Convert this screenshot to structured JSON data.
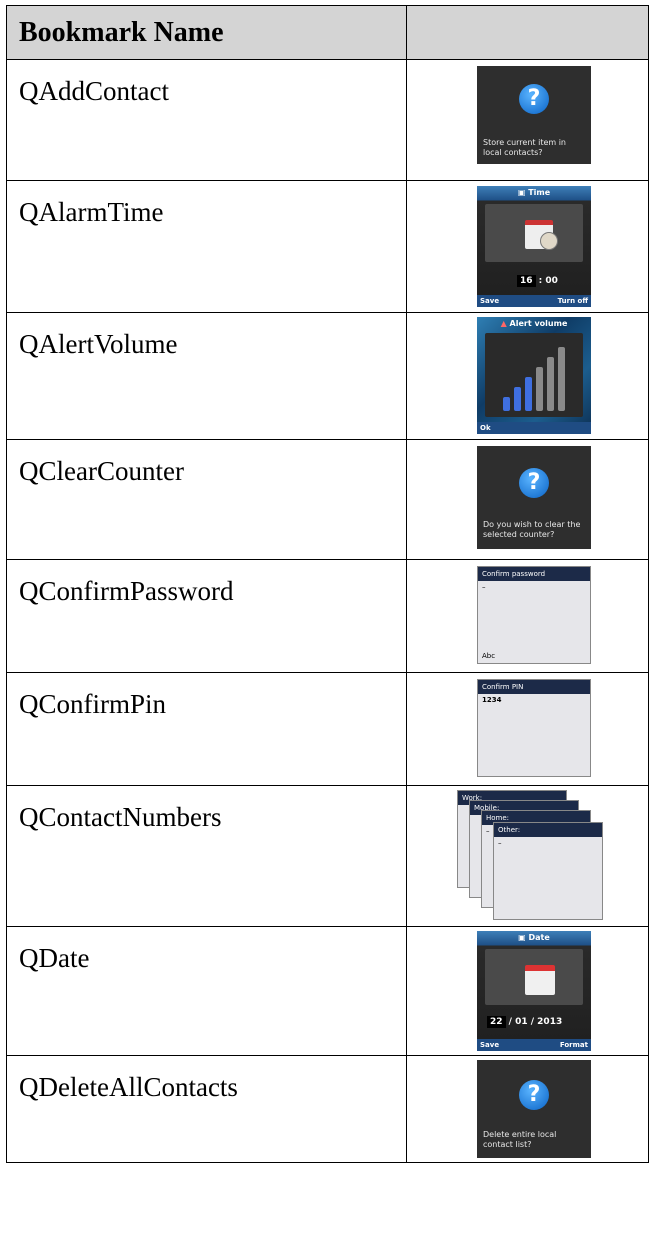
{
  "table": {
    "header": {
      "name_col": "Bookmark Name",
      "img_col": ""
    },
    "rows": [
      {
        "name": "QAddContact",
        "thumb": {
          "kind": "question",
          "text": "Store current item in local contacts?"
        }
      },
      {
        "name": "QAlarmTime",
        "thumb": {
          "kind": "time",
          "title": "Time",
          "hour": "16",
          "sep": ":",
          "minute": "00",
          "left": "Save",
          "right": "Turn off"
        }
      },
      {
        "name": "QAlertVolume",
        "thumb": {
          "kind": "volume",
          "title": "Alert volume",
          "left": "Ok",
          "level": 0.4
        }
      },
      {
        "name": "QClearCounter",
        "thumb": {
          "kind": "question",
          "text": "Do you wish to clear the selected counter?"
        }
      },
      {
        "name": "QConfirmPassword",
        "thumb": {
          "kind": "form",
          "header": "Confirm password",
          "value": "–",
          "footer": "Abc"
        }
      },
      {
        "name": "QConfirmPin",
        "thumb": {
          "kind": "form",
          "header": "Confirm PIN",
          "value": "1234",
          "footer": ""
        }
      },
      {
        "name": "QContactNumbers",
        "thumb": {
          "kind": "stack",
          "labels": [
            "Work:",
            "Mobile:",
            "Home:",
            "Other:"
          ],
          "value": "–"
        }
      },
      {
        "name": "QDate",
        "thumb": {
          "kind": "date",
          "title": "Date",
          "day": "22",
          "rest": "/ 01 / 2013",
          "left": "Save",
          "right": "Format"
        }
      },
      {
        "name": "QDeleteAllContacts",
        "thumb": {
          "kind": "question",
          "text": "Delete entire local contact list?"
        }
      }
    ]
  },
  "colors": {
    "header_bg": "#d4d4d4",
    "phone_blue": "#1f4c83",
    "form_header": "#1c2a48",
    "question_blue": "#0a63c6"
  }
}
